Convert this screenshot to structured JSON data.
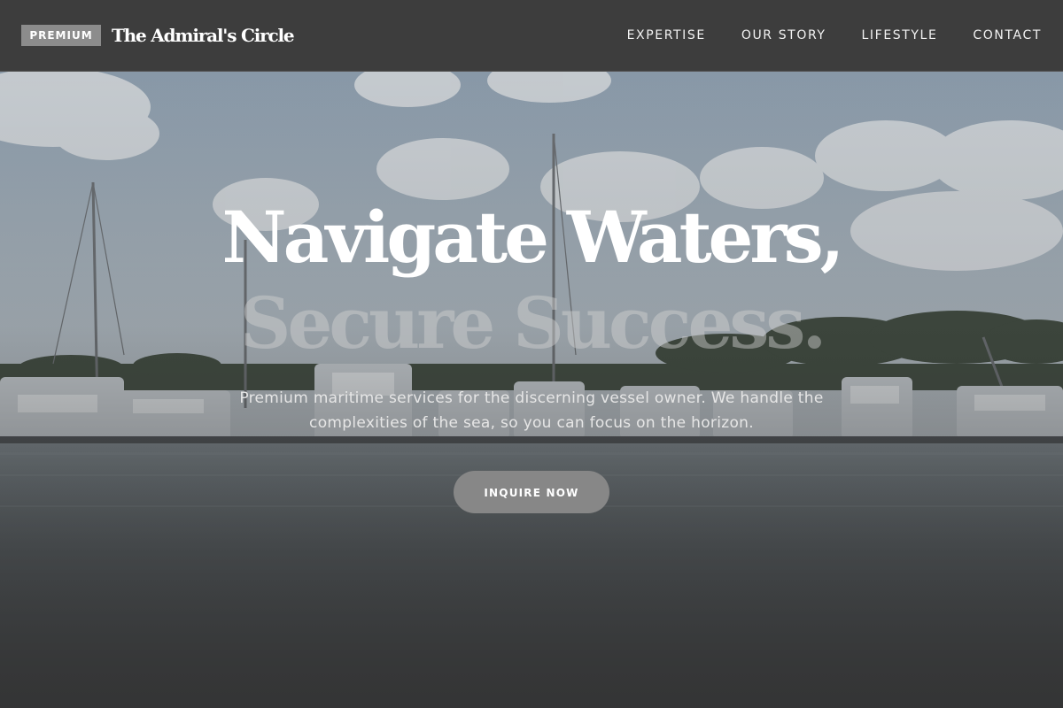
{
  "header": {
    "badge": "PREMIUM",
    "brand": "The Admiral's Circle",
    "nav": [
      {
        "label": "EXPERTISE"
      },
      {
        "label": "OUR STORY"
      },
      {
        "label": "LIFESTYLE"
      },
      {
        "label": "CONTACT"
      }
    ]
  },
  "hero": {
    "title_line1": "Navigate Waters,",
    "title_line2": "Secure Success.",
    "subtitle": "Premium maritime services for the discerning vessel owner. We handle the complexities of the sea, so you can focus on the horizon.",
    "cta_label": "INQUIRE NOW"
  },
  "colors": {
    "header_bg": "#3d3d3d",
    "badge_bg": "#8c8c8c",
    "cta_bg": "#878787",
    "title": "#ffffff"
  }
}
